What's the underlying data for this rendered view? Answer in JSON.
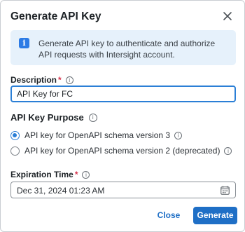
{
  "dialog": {
    "title": "Generate API Key",
    "close_icon": "close-icon"
  },
  "info_banner": {
    "icon": "info-icon",
    "icon_glyph": "i",
    "text": "Generate API key to authenticate and authorize API requests with Intersight account."
  },
  "description": {
    "label": "Description",
    "required_mark": "*",
    "hint_glyph": "i",
    "value": "API Key for FC"
  },
  "api_key_purpose": {
    "title": "API Key Purpose",
    "hint_glyph": "i",
    "options": [
      {
        "label": "API key for OpenAPI schema version 3",
        "selected": true
      },
      {
        "label": "API key for OpenAPI schema version 2 (deprecated)",
        "selected": false
      }
    ]
  },
  "expiration_time": {
    "label": "Expiration Time",
    "required_mark": "*",
    "hint_glyph": "i",
    "value": "Dec 31, 2024 01:23 AM",
    "icon": "calendar-icon"
  },
  "actions": {
    "close_label": "Close",
    "generate_label": "Generate"
  },
  "colors": {
    "accent": "#1f6fc6",
    "banner_bg": "#e6f1fb",
    "required": "#d6304a"
  }
}
